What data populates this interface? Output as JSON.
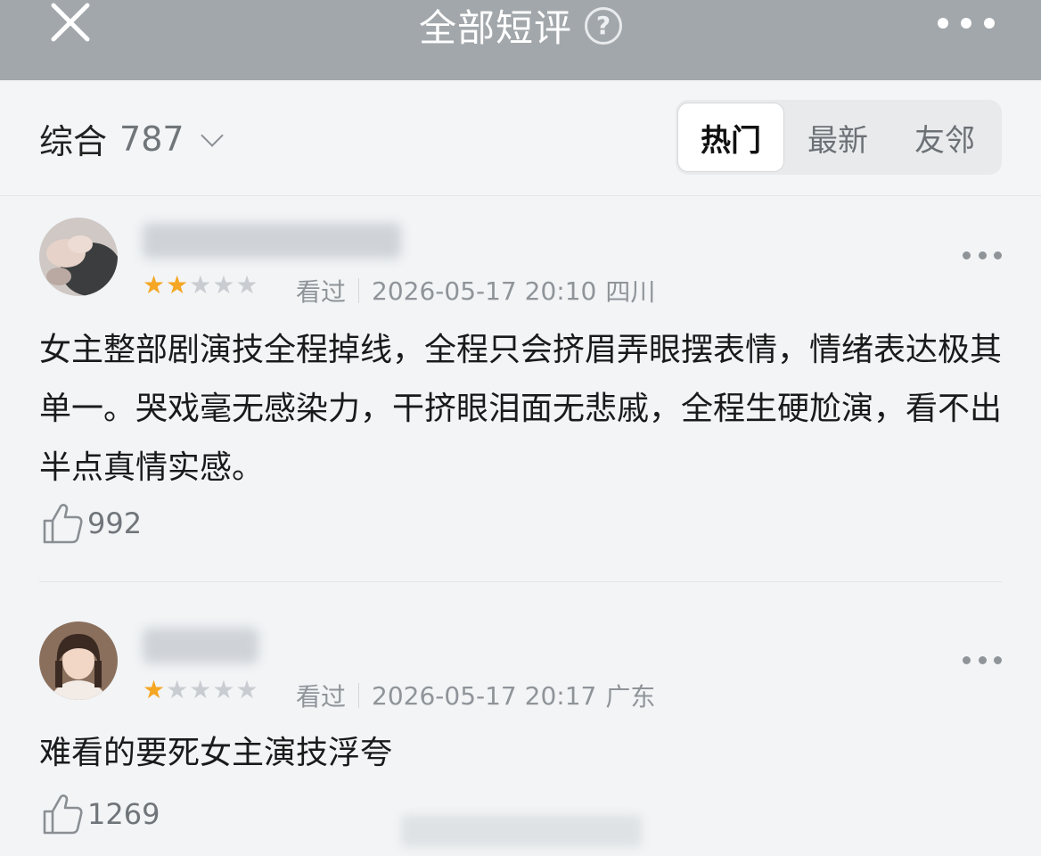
{
  "header": {
    "title": "全部短评",
    "help_glyph": "?",
    "icons": [
      "close-icon",
      "help-icon",
      "more-icon"
    ]
  },
  "filter": {
    "sort_label": "综合",
    "sort_count": "787",
    "tabs": [
      {
        "label": "热门",
        "active": true
      },
      {
        "label": "最新",
        "active": false
      },
      {
        "label": "友邻",
        "active": false
      }
    ]
  },
  "reviews": [
    {
      "rating": 2,
      "max_rating": 5,
      "status": "看过",
      "datetime": "2026-05-17 20:10",
      "location": "四川",
      "content": "女主整部剧演技全程掉线，全程只会挤眉弄眼摆表情，情绪表达极其单一。哭戏毫无感染力，干挤眼泪面无悲戚，全程生硬尬演，看不出半点真情实感。",
      "likes": "992"
    },
    {
      "rating": 1,
      "max_rating": 5,
      "status": "看过",
      "datetime": "2026-05-17 20:17",
      "location": "广东",
      "content": "难看的要死女主演技浮夸",
      "likes": "1269"
    }
  ],
  "colors": {
    "header_bg": "#a2a7ab",
    "page_bg": "#f2f4f6",
    "star_on": "#f5a623",
    "star_off": "#c9cdd1"
  }
}
